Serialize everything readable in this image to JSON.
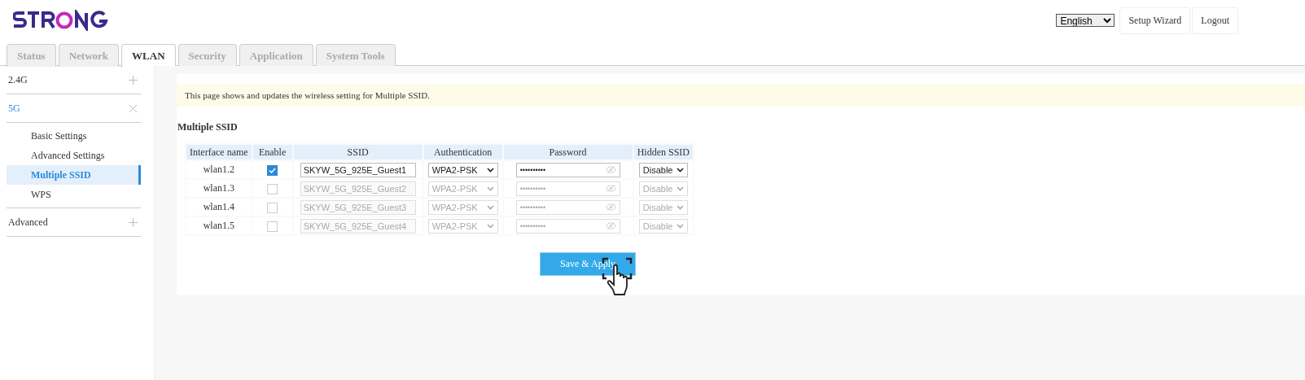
{
  "header": {
    "language": "English",
    "buttons": [
      "Setup Wizard",
      "Logout"
    ]
  },
  "tabs": [
    {
      "label": "Status",
      "selected": false
    },
    {
      "label": "Network",
      "selected": false
    },
    {
      "label": "WLAN",
      "selected": true
    },
    {
      "label": "Security",
      "selected": false
    },
    {
      "label": "Application",
      "selected": false
    },
    {
      "label": "System Tools",
      "selected": false
    }
  ],
  "sidebar": {
    "groups": [
      {
        "label": "2.4G",
        "expanded": false
      },
      {
        "label": "5G",
        "expanded": true,
        "children": [
          {
            "label": "Basic Settings",
            "selected": false
          },
          {
            "label": "Advanced Settings",
            "selected": false
          },
          {
            "label": "Multiple SSID",
            "selected": true
          },
          {
            "label": "WPS",
            "selected": false
          }
        ]
      },
      {
        "label": "Advanced",
        "expanded": false
      }
    ]
  },
  "notice": "This page shows and updates the wireless setting for Multiple SSID.",
  "section_title": "Multiple SSID",
  "table": {
    "columns": [
      "Interface name",
      "Enable",
      "SSID",
      "Authentication",
      "Password",
      "Hidden SSID"
    ],
    "rows": [
      {
        "interface": "wlan1.2",
        "checked": true,
        "ssid": "SKYW_5G_925E_Guest1",
        "auth": "WPA2-PSK",
        "password": "••••••••••",
        "hidden": "Disable"
      },
      {
        "interface": "wlan1.3",
        "checked": false,
        "ssid": "SKYW_5G_925E_Guest2",
        "auth": "WPA2-PSK",
        "password": "••••••••••",
        "hidden": "Disable"
      },
      {
        "interface": "wlan1.4",
        "checked": false,
        "ssid": "SKYW_5G_925E_Guest3",
        "auth": "WPA2-PSK",
        "password": "••••••••••",
        "hidden": "Disable"
      },
      {
        "interface": "wlan1.5",
        "checked": false,
        "ssid": "SKYW_5G_925E_Guest4",
        "auth": "WPA2-PSK",
        "password": "••••••••••",
        "hidden": "Disable"
      }
    ]
  },
  "save_button": "Save & Apply"
}
